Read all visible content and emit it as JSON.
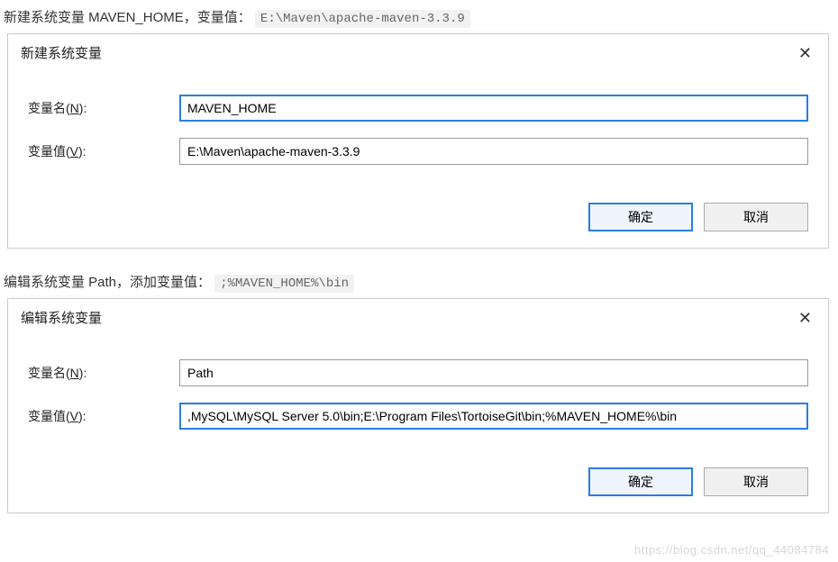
{
  "section1": {
    "intro_prefix": "新建系统变量 MAVEN_HOME，变量值：",
    "intro_code": "E:\\Maven\\apache-maven-3.3.9",
    "dialog": {
      "title": "新建系统变量",
      "close_glyph": "✕",
      "name_label_prefix": "变量名(",
      "name_label_key": "N",
      "name_label_suffix": "):",
      "name_value": "MAVEN_HOME",
      "value_label_prefix": "变量值(",
      "value_label_key": "V",
      "value_label_suffix": "):",
      "value_value": "E:\\Maven\\apache-maven-3.3.9",
      "ok_label": "确定",
      "cancel_label": "取消"
    }
  },
  "section2": {
    "intro_prefix": "编辑系统变量 Path，添加变量值：",
    "intro_code": ";%MAVEN_HOME%\\bin",
    "dialog": {
      "title": "编辑系统变量",
      "close_glyph": "✕",
      "name_label_prefix": "变量名(",
      "name_label_key": "N",
      "name_label_suffix": "):",
      "name_value": "Path",
      "value_label_prefix": "变量值(",
      "value_label_key": "V",
      "value_label_suffix": "):",
      "value_value": ",MySQL\\MySQL Server 5.0\\bin;E:\\Program Files\\TortoiseGit\\bin;%MAVEN_HOME%\\bin",
      "ok_label": "确定",
      "cancel_label": "取消"
    }
  },
  "watermark": "https://blog.csdn.net/qq_44084784"
}
